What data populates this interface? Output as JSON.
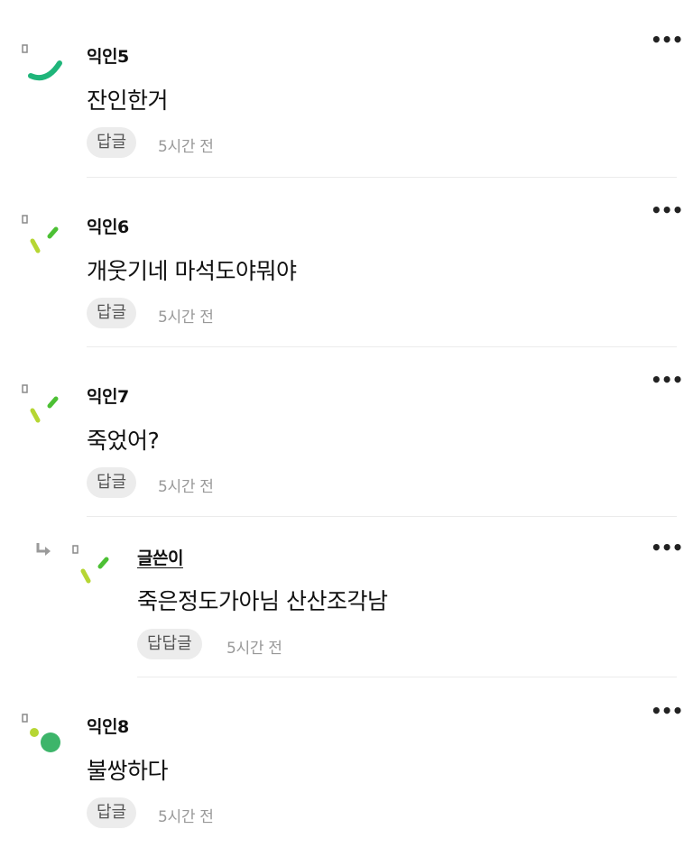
{
  "comments": [
    {
      "name": "익인5",
      "text": "잔인한거",
      "reply_label": "답글",
      "time": "5시간 전",
      "more": "•••",
      "avatar": "green-arc-icon"
    },
    {
      "name": "익인6",
      "text": "개웃기네 마석도야뭐야",
      "reply_label": "답글",
      "time": "5시간 전",
      "more": "•••",
      "avatar": "lime-dash-icon"
    },
    {
      "name": "익인7",
      "text": "죽었어?",
      "reply_label": "답글",
      "time": "5시간 전",
      "more": "•••",
      "avatar": "lime-dash-icon"
    },
    {
      "name": "글쓴이",
      "text": "죽은정도가아님 산산조각남",
      "reply_label": "답답글",
      "time": "5시간 전",
      "more": "•••",
      "avatar": "lime-dash-icon"
    },
    {
      "name": "익인8",
      "text": "불쌍하다",
      "reply_label": "답글",
      "time": "5시간 전",
      "more": "•••",
      "avatar": "green-dots-icon"
    }
  ],
  "colors": {
    "accent_green": "#1fb57a",
    "lime": "#b6d633",
    "bright_green": "#4cc034",
    "dot_green": "#3db56a"
  }
}
